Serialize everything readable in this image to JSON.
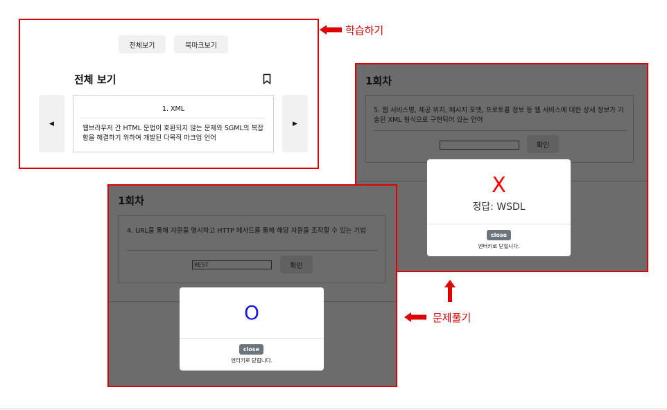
{
  "labels": {
    "learn": "학습하기",
    "solve": "문제풀기"
  },
  "study": {
    "tab_all": "전체보기",
    "tab_bookmark": "북마크보기",
    "heading": "전체 보기",
    "prev": "◀",
    "next": "▶",
    "card_title": "1. XML",
    "card_body": "웹브라우저 간 HTML 문법이 호환되지 않는 문제와 SGML의 복잡함을 해결하기 위하여 개발된 다목적 마크업 언어"
  },
  "quiz_wrong": {
    "round": "1회차",
    "question": "5. 웹 서비스명, 제공 위치, 메시지 포맷, 프로토콜 정보 등 웹 서비스에 대한 상세 정보가 기술된 XML 형식으로 구현되어 있는 언어",
    "answer_value": "",
    "confirm": "확인",
    "mark": "X",
    "result": "정답: WSDL",
    "close": "close",
    "hint": "엔터키로 닫힙니다."
  },
  "quiz_right": {
    "round": "1회차",
    "question": "4. URL을 통해 자원을 명시하고 HTTP 메서드를 통해 해당 자원을 조작할 수 있는 기법",
    "answer_value": "REST",
    "confirm": "확인",
    "mark": "O",
    "close": "close",
    "hint": "엔터키로 닫힙니다."
  },
  "colors": {
    "frame": "#e00000",
    "wrong_mark": "#ff0000",
    "right_mark": "#1a1ae0",
    "overlay": "#6c6c6c",
    "close_button": "#6c757d"
  }
}
